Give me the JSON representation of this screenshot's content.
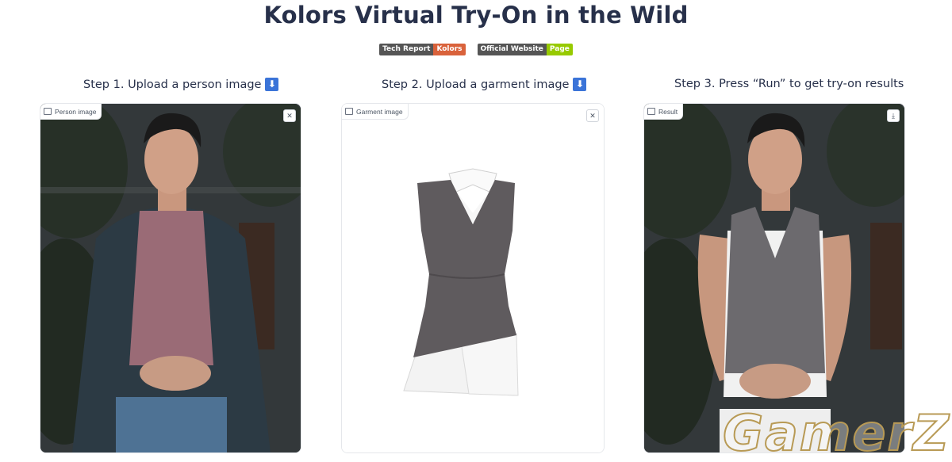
{
  "title": "Kolors Virtual Try-On in the Wild",
  "badges": [
    {
      "left": "Tech Report",
      "right": "Kolors",
      "color": "#d9623b"
    },
    {
      "left": "Official Website",
      "right": "Page",
      "color": "#97ca00"
    }
  ],
  "steps": {
    "step1": "Step 1. Upload a person image",
    "step2": "Step 2. Upload a garment image",
    "step3": "Step 3. Press “Run” to get try-on results",
    "arrow": "⬇"
  },
  "panels": {
    "person": {
      "label": "Person image",
      "button": "✕"
    },
    "garment": {
      "label": "Garment image",
      "button": "✕"
    },
    "result": {
      "label": "Result",
      "button": "⤓"
    }
  },
  "watermark": "GamerZ"
}
